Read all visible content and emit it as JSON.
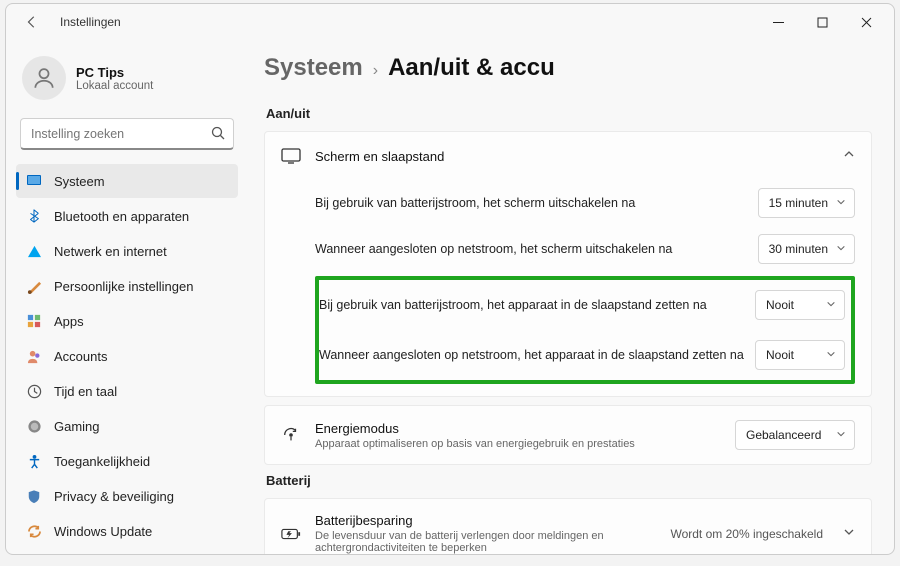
{
  "titlebar": {
    "title": "Instellingen"
  },
  "user": {
    "name": "PC Tips",
    "sub": "Lokaal account"
  },
  "search": {
    "placeholder": "Instelling zoeken"
  },
  "nav": {
    "items": [
      {
        "label": "Systeem"
      },
      {
        "label": "Bluetooth en apparaten"
      },
      {
        "label": "Netwerk en internet"
      },
      {
        "label": "Persoonlijke instellingen"
      },
      {
        "label": "Apps"
      },
      {
        "label": "Accounts"
      },
      {
        "label": "Tijd en taal"
      },
      {
        "label": "Gaming"
      },
      {
        "label": "Toegankelijkheid"
      },
      {
        "label": "Privacy & beveiliging"
      },
      {
        "label": "Windows Update"
      }
    ]
  },
  "breadcrumb": {
    "parent": "Systeem",
    "sep": "›",
    "current": "Aan/uit & accu"
  },
  "sections": {
    "aanuit": {
      "label": "Aan/uit",
      "screencard": {
        "title": "Scherm en slaapstand",
        "rows": [
          {
            "label": "Bij gebruik van batterijstroom, het scherm uitschakelen na",
            "value": "15 minuten"
          },
          {
            "label": "Wanneer aangesloten op netstroom, het scherm uitschakelen na",
            "value": "30 minuten"
          },
          {
            "label": "Bij gebruik van batterijstroom, het apparaat in de slaapstand zetten na",
            "value": "Nooit"
          },
          {
            "label": "Wanneer aangesloten op netstroom, het apparaat in de slaapstand zetten na",
            "value": "Nooit"
          }
        ]
      },
      "energy": {
        "title": "Energiemodus",
        "sub": "Apparaat optimaliseren op basis van energiegebruik en prestaties",
        "value": "Gebalanceerd"
      }
    },
    "batterij": {
      "label": "Batterij",
      "saver": {
        "title": "Batterijbesparing",
        "sub": "De levensduur van de batterij verlengen door meldingen en achtergrondactiviteiten te beperken",
        "value": "Wordt om 20% ingeschakeld"
      }
    }
  }
}
